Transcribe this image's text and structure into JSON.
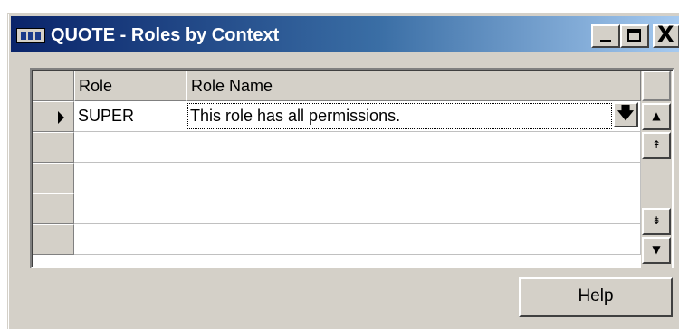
{
  "window": {
    "title": "QUOTE - Roles by Context",
    "controls": {
      "minimize": "_",
      "maximize": "□",
      "close": "X"
    }
  },
  "grid": {
    "columns": [
      "Role",
      "Role Name"
    ],
    "rows": [
      {
        "role": "SUPER",
        "role_name": "This role has all permissions."
      },
      {
        "role": "",
        "role_name": ""
      },
      {
        "role": "",
        "role_name": ""
      },
      {
        "role": "",
        "role_name": ""
      },
      {
        "role": "",
        "role_name": ""
      }
    ],
    "current_row_indicator": "triangle-right",
    "dropdown_icon": "arrow-down-icon"
  },
  "scrollbar": {
    "line_up": "▲",
    "page_up": "⇞",
    "page_down": "⇟",
    "line_down": "▼"
  },
  "buttons": {
    "help": "Help"
  }
}
